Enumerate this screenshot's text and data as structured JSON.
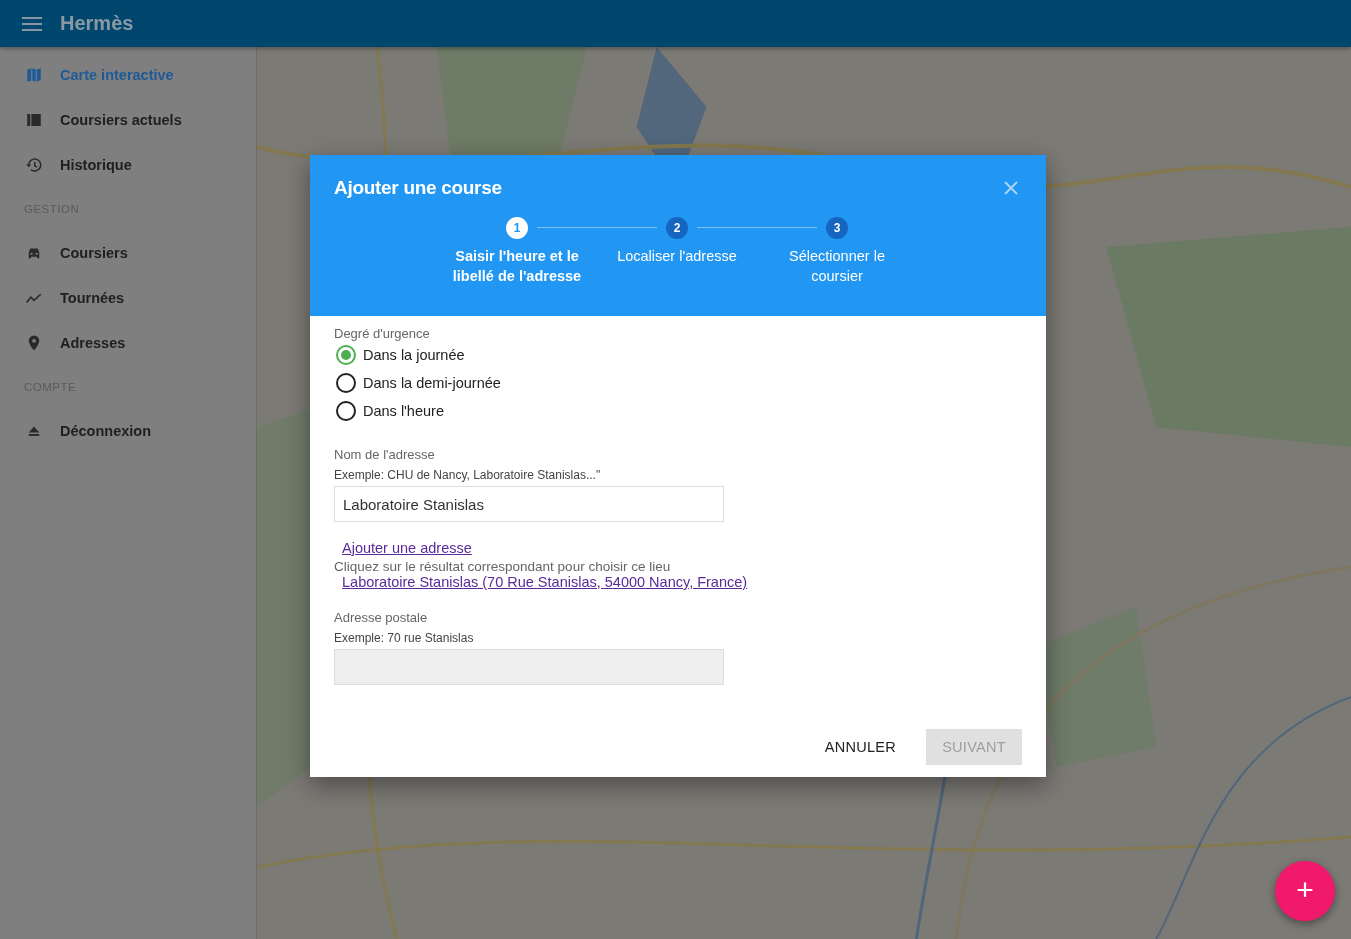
{
  "app_bar": {
    "title": "Hermès"
  },
  "sidebar": {
    "groups": [
      {
        "items": [
          {
            "label": "Carte interactive",
            "selected": true
          },
          {
            "label": "Coursiers actuels",
            "selected": false
          },
          {
            "label": "Historique",
            "selected": false
          }
        ]
      },
      {
        "heading": "GESTION",
        "items": [
          {
            "label": "Coursiers",
            "selected": false
          },
          {
            "label": "Tournées",
            "selected": false
          },
          {
            "label": "Adresses",
            "selected": false
          }
        ]
      },
      {
        "heading": "COMPTE",
        "items": [
          {
            "label": "Déconnexion",
            "selected": false
          }
        ]
      }
    ]
  },
  "dialog": {
    "title": "Ajouter une course",
    "steps": [
      {
        "number": "1",
        "label": "Saisir l'heure et le libellé de l'adresse",
        "selected": true
      },
      {
        "number": "2",
        "label": "Localiser l'adresse",
        "selected": false
      },
      {
        "number": "3",
        "label": "Sélectionner le coursier",
        "selected": false
      }
    ],
    "urgency": {
      "label": "Degré d'urgence",
      "options": [
        {
          "label": "Dans la journée",
          "selected": true
        },
        {
          "label": "Dans la demi-journée",
          "selected": false
        },
        {
          "label": "Dans l'heure",
          "selected": false
        }
      ]
    },
    "name_field": {
      "label": "Nom de l'adresse",
      "hint": "Exemple: CHU de Nancy, Laboratoire Stanislas...\"",
      "value": "Laboratoire Stanislas"
    },
    "add_link": "Ajouter une adresse",
    "instruction": "Cliquez sur le résultat correspondant pour choisir ce lieu",
    "result_link": "Laboratoire Stanislas (70 Rue Stanislas, 54000 Nancy, France)",
    "postal_field": {
      "label": "Adresse postale",
      "hint": "Exemple: 70 rue Stanislas",
      "disabled": true
    },
    "buttons": [
      {
        "label": "ANNULER",
        "disabled": false
      },
      {
        "label": "SUIVANT",
        "disabled": true
      }
    ]
  },
  "fab": {
    "label": "+"
  }
}
